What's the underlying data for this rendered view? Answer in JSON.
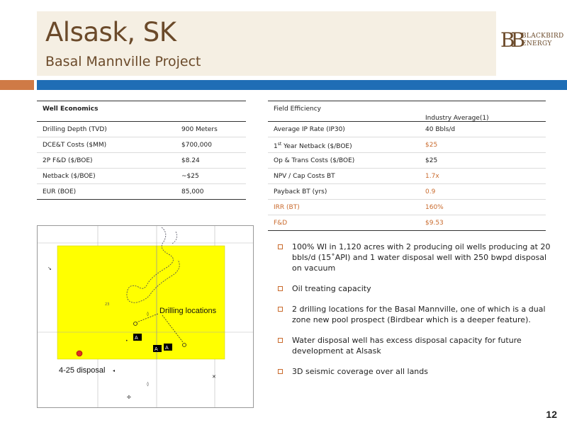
{
  "header": {
    "title": "Alsask, SK",
    "subtitle": "Basal Mannville Project"
  },
  "logo": {
    "mark": "BB",
    "line1": "BLACKBIRD",
    "line2": "ENERGY"
  },
  "well_economics": {
    "header": "Well Economics",
    "rows": [
      {
        "label": "Drilling Depth (TVD)",
        "value": "900 Meters"
      },
      {
        "label": "DCE&T Costs ($MM)",
        "value": "$700,000"
      },
      {
        "label": "2P F&D ($/BOE)",
        "value": "$8.24"
      },
      {
        "label": "Netback ($/BOE)",
        "value": "~$25"
      },
      {
        "label": "EUR (BOE)",
        "value": "85,000"
      }
    ]
  },
  "field_efficiency": {
    "header": "Field Efficiency",
    "column": "Industry Average(1)",
    "rows": [
      {
        "label": "Average IP Rate (IP30)",
        "value": "40 Bbls/d"
      },
      {
        "label_pre": "1",
        "label_sup": "st",
        "label": " Year Netback ($/BOE)",
        "value": "$25"
      },
      {
        "label": "Op  & Trans Costs ($/BOE)",
        "value": "$25"
      },
      {
        "label": "NPV / Cap Costs BT",
        "value": "1.7x"
      },
      {
        "label": "Payback BT (yrs)",
        "value": "0.9"
      },
      {
        "label": "IRR (BT)",
        "value": "160%"
      },
      {
        "label": "F&D",
        "value": "$9.53"
      }
    ]
  },
  "map": {
    "drilling_label": "Drilling locations",
    "disposal_label": "4-25 disposal",
    "highlight_color": "#ffff00"
  },
  "bullets": [
    "100% WI in 1,120 acres with 2 producing oil wells producing at 20 bbls/d (15˚API) and 1 water disposal well with 250 bwpd disposal on vacuum",
    "Oil treating capacity",
    "2 drilling locations for the Basal Mannville, one of which is a dual zone new pool prospect (Birdbear which is a deeper feature).",
    "Water disposal well has excess disposal capacity for future development at Alsask",
    "3D seismic coverage over all lands"
  ],
  "page_number": "12"
}
